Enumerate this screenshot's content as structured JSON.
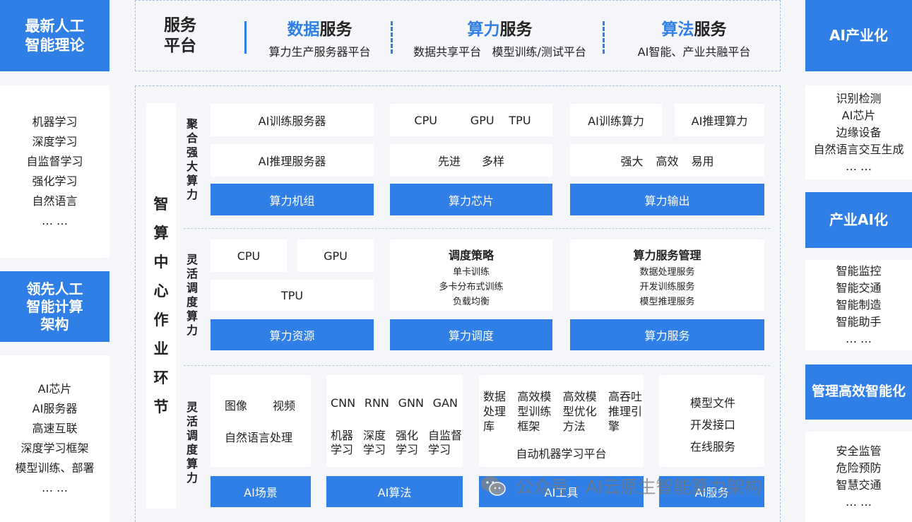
{
  "left": {
    "box1_title": "最新人工\n智能理论",
    "list1": [
      "机器学习",
      "深度学习",
      "自监督学习",
      "强化学习",
      "自然语言",
      "… …"
    ],
    "box2_title": "领先人工\n智能计算\n架构",
    "list2": [
      "AI芯片",
      "AI服务器",
      "高速互联",
      "深度学习框架",
      "模型训练、部署",
      "… …"
    ]
  },
  "right": {
    "box1_title": "AI产业化",
    "list1": [
      "识别检测",
      "AI芯片",
      "边缘设备",
      "自然语言交互生成",
      "… …"
    ],
    "box2_title": "产业AI化",
    "list2": [
      "智能监控",
      "智能交通",
      "智能制造",
      "智能助手",
      "… …"
    ],
    "box3_title": "管理高效智能化",
    "list3": [
      "安全监管",
      "危险预防",
      "智慧交通",
      "… …"
    ]
  },
  "top": {
    "platform": "服务\n平台",
    "s1_a": "数据",
    "s1_b": "服务",
    "s1_sub": "算力生产服务器平台",
    "s2_a": "算力",
    "s2_b": "服务",
    "s2_sub1": "数据共享平台",
    "s2_sub2": "模型训练/测试平台",
    "s3_a": "算法",
    "s3_b": "服务",
    "s3_sub": "AI智能、产业共融平台"
  },
  "center": {
    "vertical_title": "智算中心作业环节",
    "row1": {
      "label": "聚合强大算力",
      "t1": "AI训练服务器",
      "t2": "AI推理服务器",
      "t3a": "CPU",
      "t3b": "GPU",
      "t3c": "TPU",
      "t4a": "先进",
      "t4b": "多样",
      "t5": "AI训练算力",
      "t6": "AI推理算力",
      "t7a": "强大",
      "t7b": "高效",
      "t7c": "易用",
      "b1": "算力机组",
      "b2": "算力芯片",
      "b3": "算力输出"
    },
    "row2": {
      "label": "灵活调度算力",
      "cpu": "CPU",
      "gpu": "GPU",
      "tpu": "TPU",
      "sched_title": "调度策略",
      "sched_items": [
        "单卡训练",
        "多卡分布式训练",
        "负载均衡"
      ],
      "svc_title": "算力服务管理",
      "svc_items": [
        "数据处理服务",
        "开发训练服务",
        "模型推理服务"
      ],
      "b1": "算力资源",
      "b2": "算力调度",
      "b3": "算力服务"
    },
    "row3": {
      "label": "灵活调度算力",
      "img": "图像",
      "video": "视频",
      "nlp": "自然语言处理",
      "alg1": "CNN",
      "alg2": "RNN",
      "alg3": "GNN",
      "alg4": "GAN",
      "alg5": "机器\n学习",
      "alg6": "深度\n学习",
      "alg7": "强化\n学习",
      "alg8": "自监督\n学习",
      "tool1": "数据\n处理\n库",
      "tool2": "高效模\n型训练\n框架",
      "tool3": "高效模\n型优化\n方法",
      "tool4": "高吞吐\n推理引\n擎",
      "tool_platform": "自动机器学习平台",
      "svc1": "模型文件",
      "svc2": "开发接口",
      "svc3": "在线服务",
      "b1": "AI场景",
      "b2": "AI算法",
      "b3": "AI工具",
      "b4": "AI服务"
    }
  },
  "watermark": "公众号 · AI云原生智能算力架构"
}
